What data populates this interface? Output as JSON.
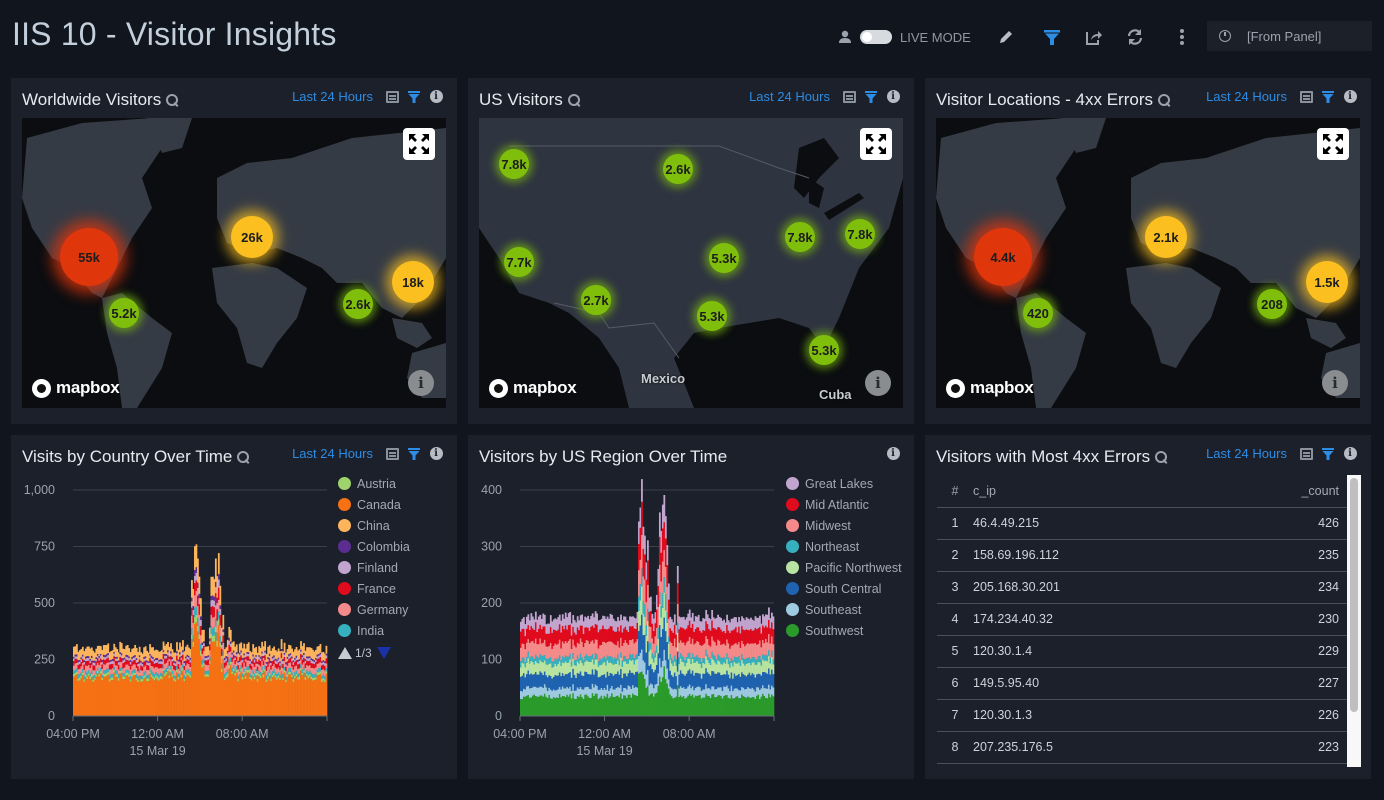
{
  "header": {
    "title": "IIS 10 - Visitor Insights",
    "live_mode_label": "LIVE MODE",
    "live_mode_on": false,
    "time_range": "[From Panel]",
    "icons": [
      "user-icon",
      "edit-icon",
      "filter-icon",
      "share-icon",
      "refresh-icon",
      "more-icon",
      "clock-icon"
    ]
  },
  "colors": {
    "accent": "#2d8ce3",
    "cluster_high": "#e0360c",
    "cluster_mid": "#fbc020",
    "cluster_low": "#7fbf0c"
  },
  "panels": {
    "worldwide": {
      "title": "Worldwide Visitors",
      "time": "Last 24 Hours",
      "attribution": "mapbox",
      "clusters": [
        {
          "label": "55k",
          "level": "high",
          "region": "North America"
        },
        {
          "label": "26k",
          "level": "mid",
          "region": "Europe"
        },
        {
          "label": "18k",
          "level": "mid",
          "region": "East Asia"
        },
        {
          "label": "5.2k",
          "level": "low",
          "region": "Central America"
        },
        {
          "label": "2.6k",
          "level": "low",
          "region": "India"
        }
      ]
    },
    "us": {
      "title": "US Visitors",
      "time": "Last 24 Hours",
      "attribution": "mapbox",
      "place_labels": [
        "Mexico",
        "Cuba"
      ],
      "clusters": [
        {
          "label": "7.8k",
          "level": "low",
          "region": "Pacific Northwest"
        },
        {
          "label": "2.6k",
          "level": "low",
          "region": "North Central"
        },
        {
          "label": "7.8k",
          "level": "low",
          "region": "Great Lakes"
        },
        {
          "label": "7.8k",
          "level": "low",
          "region": "Northeast"
        },
        {
          "label": "7.7k",
          "level": "low",
          "region": "California"
        },
        {
          "label": "5.3k",
          "level": "low",
          "region": "Central"
        },
        {
          "label": "2.7k",
          "level": "low",
          "region": "Southwest"
        },
        {
          "label": "5.3k",
          "level": "low",
          "region": "Texas"
        },
        {
          "label": "5.3k",
          "level": "low",
          "region": "Florida"
        }
      ]
    },
    "errors_map": {
      "title": "Visitor Locations - 4xx Errors",
      "time": "Last 24 Hours",
      "attribution": "mapbox",
      "clusters": [
        {
          "label": "4.4k",
          "level": "high",
          "region": "North America"
        },
        {
          "label": "2.1k",
          "level": "mid",
          "region": "Europe"
        },
        {
          "label": "1.5k",
          "level": "mid",
          "region": "East Asia"
        },
        {
          "label": "420",
          "level": "low",
          "region": "Central America"
        },
        {
          "label": "208",
          "level": "low",
          "region": "India"
        }
      ]
    },
    "country_time": {
      "title": "Visits by Country Over Time",
      "time": "Last 24 Hours",
      "legend_page": "1/3"
    },
    "region_time": {
      "title": "Visitors by US Region Over Time"
    },
    "errors_table": {
      "title": "Visitors with Most 4xx Errors",
      "time": "Last 24 Hours",
      "columns": [
        "#",
        "c_ip",
        "_count"
      ],
      "rows": [
        {
          "n": "1",
          "ip": "46.4.49.215",
          "count": "426"
        },
        {
          "n": "2",
          "ip": "158.69.196.112",
          "count": "235"
        },
        {
          "n": "3",
          "ip": "205.168.30.201",
          "count": "234"
        },
        {
          "n": "4",
          "ip": "174.234.40.32",
          "count": "230"
        },
        {
          "n": "5",
          "ip": "120.30.1.4",
          "count": "229"
        },
        {
          "n": "6",
          "ip": "149.5.95.40",
          "count": "227"
        },
        {
          "n": "7",
          "ip": "120.30.1.3",
          "count": "226"
        },
        {
          "n": "8",
          "ip": "207.235.176.5",
          "count": "223"
        }
      ]
    }
  },
  "chart_data": [
    {
      "type": "bar",
      "stacked": true,
      "title": "Visits by Country Over Time",
      "xlabel": "",
      "ylabel": "",
      "ylim": [
        0,
        1000
      ],
      "yticks": [
        "0",
        "250",
        "500",
        "750",
        "1,000"
      ],
      "xticks": [
        "04:00 PM",
        "12:00 AM",
        "08:00 AM"
      ],
      "xsublabel": "15 Mar 19",
      "grid": true,
      "legend_position": "right",
      "series": [
        {
          "name": "Austria",
          "color": "#9ed46b",
          "typical": 12,
          "spike": 25
        },
        {
          "name": "Canada",
          "color": "#f57113",
          "typical": 175,
          "spike": 340
        },
        {
          "name": "China",
          "color": "#fdb55c",
          "typical": 40,
          "spike": 90
        },
        {
          "name": "Colombia",
          "color": "#5c2d91",
          "typical": 8,
          "spike": 20
        },
        {
          "name": "Finland",
          "color": "#c2a5cf",
          "typical": 12,
          "spike": 30
        },
        {
          "name": "France",
          "color": "#e00b1c",
          "typical": 20,
          "spike": 45
        },
        {
          "name": "Germany",
          "color": "#f58a8a",
          "typical": 25,
          "spike": 55
        },
        {
          "name": "India",
          "color": "#36b0bf",
          "typical": 15,
          "spike": 35
        }
      ],
      "baseline_total": 340,
      "peak_total": 760,
      "spike_window": [
        "04:00 AM",
        "07:00 AM"
      ]
    },
    {
      "type": "bar",
      "stacked": true,
      "title": "Visitors by US Region Over Time",
      "ylim": [
        0,
        400
      ],
      "yticks": [
        "0",
        "100",
        "200",
        "300",
        "400"
      ],
      "xticks": [
        "04:00 PM",
        "12:00 AM",
        "08:00 AM"
      ],
      "xsublabel": "15 Mar 19",
      "grid": true,
      "legend_position": "right",
      "series": [
        {
          "name": "Great Lakes",
          "color": "#c2a5cf",
          "typical": 20,
          "spike": 40
        },
        {
          "name": "Mid Atlantic",
          "color": "#e00b1c",
          "typical": 25,
          "spike": 50
        },
        {
          "name": "Midwest",
          "color": "#f58a8a",
          "typical": 25,
          "spike": 50
        },
        {
          "name": "Northeast",
          "color": "#36b0bf",
          "typical": 10,
          "spike": 25
        },
        {
          "name": "Pacific Northwest",
          "color": "#b8e3a0",
          "typical": 20,
          "spike": 40
        },
        {
          "name": "South Central",
          "color": "#1f63b0",
          "typical": 25,
          "spike": 55
        },
        {
          "name": "Southeast",
          "color": "#9ecae1",
          "typical": 15,
          "spike": 30
        },
        {
          "name": "Southwest",
          "color": "#2a9a2a",
          "typical": 35,
          "spike": 70
        }
      ],
      "baseline_total": 170,
      "peak_total": 375,
      "spike_window": [
        "04:00 AM",
        "07:00 AM"
      ]
    }
  ]
}
